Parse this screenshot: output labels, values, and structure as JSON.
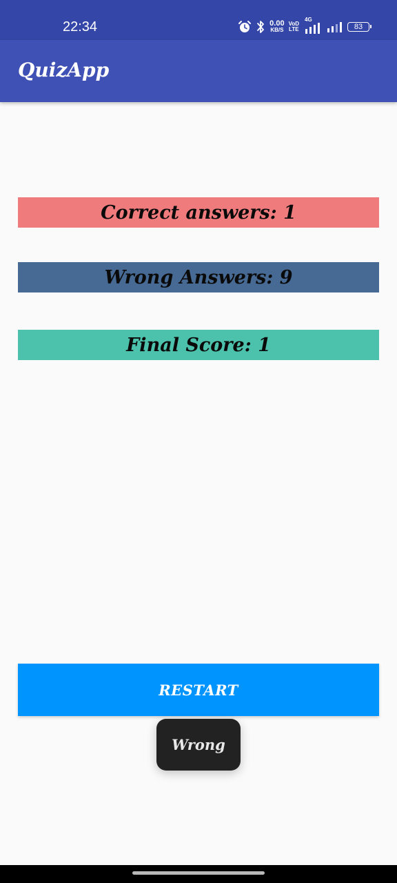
{
  "status_bar": {
    "time": "22:34",
    "speed_value": "0.00",
    "speed_unit": "KB/S",
    "volte_top": "VoD",
    "volte_bottom": "LTE",
    "network_type": "4G",
    "battery_level": "83",
    "icons": [
      "alarm-icon",
      "bluetooth-icon",
      "signal-icon",
      "signal-icon",
      "battery-icon"
    ]
  },
  "app_bar": {
    "title": "QuizApp"
  },
  "results": {
    "correct_label": "Correct answers: 1",
    "wrong_label": "Wrong Answers: 9",
    "final_label": "Final Score: 1"
  },
  "actions": {
    "restart_label": "RESTART"
  },
  "toast": {
    "message": "Wrong"
  },
  "colors": {
    "status_bar": "#3446a8",
    "app_bar": "#3f51b5",
    "correct_row": "#f07b7d",
    "wrong_row": "#476a94",
    "final_row": "#4cc1ab",
    "restart_button": "#0094ff",
    "toast": "#222222",
    "background": "#fafafa"
  }
}
